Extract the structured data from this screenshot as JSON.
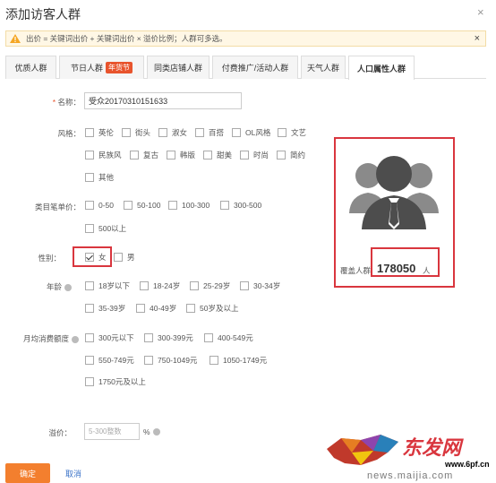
{
  "dialog": {
    "title": "添加访客人群",
    "close_glyph": "×"
  },
  "notice": {
    "text": "出价 = 关键词出价 + 关键词出价 × 溢价比例；人群可多选。",
    "close_glyph": "×"
  },
  "tabs": [
    {
      "label": "优质人群"
    },
    {
      "label": "节日人群",
      "badge": "年货节"
    },
    {
      "label": "同类店铺人群"
    },
    {
      "label": "付费推广/活动人群"
    },
    {
      "label": "天气人群"
    },
    {
      "label": "人口属性人群"
    }
  ],
  "form": {
    "name_label": "名称：",
    "name_required": "*",
    "name_value": "受众20170310151633",
    "style_label": "风格：",
    "style_options": [
      "英伦",
      "街头",
      "淑女",
      "百搭",
      "OL风格",
      "文艺",
      "民族风",
      "复古",
      "韩版",
      "甜美",
      "时尚",
      "简约",
      "其他"
    ],
    "price_label": "类目笔单价：",
    "price_options": [
      "0-50",
      "50-100",
      "100-300",
      "300-500",
      "500以上"
    ],
    "gender_label": "性别：",
    "gender_options": [
      {
        "label": "女",
        "checked": true
      },
      {
        "label": "男",
        "checked": false
      }
    ],
    "age_label": "年龄",
    "age_options": [
      "18岁以下",
      "18-24岁",
      "25-29岁",
      "30-34岁",
      "35-39岁",
      "40-49岁",
      "50岁及以上"
    ],
    "spend_label": "月均消费额度",
    "spend_options": [
      "300元以下",
      "300-399元",
      "400-549元",
      "550-749元",
      "750-1049元",
      "1050-1749元",
      "1750元及以上"
    ],
    "premium_label": "溢价：",
    "premium_placeholder": "5-300整数",
    "premium_unit": "%"
  },
  "coverage": {
    "label": "覆盖人群",
    "value": "178050",
    "unit": "人"
  },
  "buttons": {
    "ok": "确定",
    "cancel": "取消"
  },
  "watermark": {
    "brand": "东发网",
    "url": "www.6pf.cn",
    "url2": "news.maijia.com"
  },
  "colors": {
    "accent": "#f37f2e",
    "highlight": "#d9363e",
    "link": "#3b73c8"
  }
}
